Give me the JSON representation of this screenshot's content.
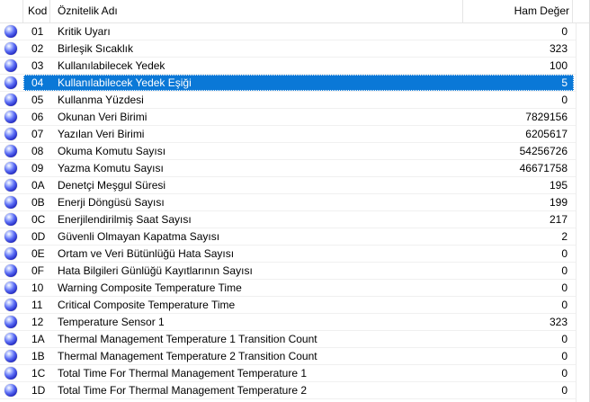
{
  "table": {
    "columns": {
      "icon": "",
      "code": "Kod",
      "name": "Öznitelik Adı",
      "value": "Ham Değer"
    },
    "selected_code": "04",
    "rows": [
      {
        "code": "01",
        "name": "Kritik Uyarı",
        "value": "0"
      },
      {
        "code": "02",
        "name": "Birleşik Sıcaklık",
        "value": "323"
      },
      {
        "code": "03",
        "name": "Kullanılabilecek Yedek",
        "value": "100"
      },
      {
        "code": "04",
        "name": "Kullanılabilecek Yedek Eşiği",
        "value": "5"
      },
      {
        "code": "05",
        "name": "Kullanma Yüzdesi",
        "value": "0"
      },
      {
        "code": "06",
        "name": "Okunan Veri Birimi",
        "value": "7829156"
      },
      {
        "code": "07",
        "name": "Yazılan Veri Birimi",
        "value": "6205617"
      },
      {
        "code": "08",
        "name": "Okuma Komutu Sayısı",
        "value": "54256726"
      },
      {
        "code": "09",
        "name": "Yazma Komutu Sayısı",
        "value": "46671758"
      },
      {
        "code": "0A",
        "name": "Denetçi Meşgul Süresi",
        "value": "195"
      },
      {
        "code": "0B",
        "name": "Enerji Döngüsü Sayısı",
        "value": "199"
      },
      {
        "code": "0C",
        "name": "Enerjilendirilmiş Saat Sayısı",
        "value": "217"
      },
      {
        "code": "0D",
        "name": "Güvenli Olmayan Kapatma Sayısı",
        "value": "2"
      },
      {
        "code": "0E",
        "name": "Ortam ve Veri Bütünlüğü Hata Sayısı",
        "value": "0"
      },
      {
        "code": "0F",
        "name": "Hata Bilgileri Günlüğü Kayıtlarının Sayısı",
        "value": "0"
      },
      {
        "code": "10",
        "name": "Warning Composite Temperature Time",
        "value": "0"
      },
      {
        "code": "11",
        "name": "Critical Composite Temperature Time",
        "value": "0"
      },
      {
        "code": "12",
        "name": "Temperature Sensor 1",
        "value": "323"
      },
      {
        "code": "1A",
        "name": "Thermal Management Temperature 1 Transition Count",
        "value": "0"
      },
      {
        "code": "1B",
        "name": "Thermal Management Temperature 2 Transition Count",
        "value": "0"
      },
      {
        "code": "1C",
        "name": "Total Time For Thermal Management Temperature 1",
        "value": "0"
      },
      {
        "code": "1D",
        "name": "Total Time For Thermal Management Temperature 2",
        "value": "0"
      }
    ],
    "status_icon": "blue-orb-icon",
    "colors": {
      "selection": "#0a78d7",
      "orb": "#3a46e0"
    }
  }
}
